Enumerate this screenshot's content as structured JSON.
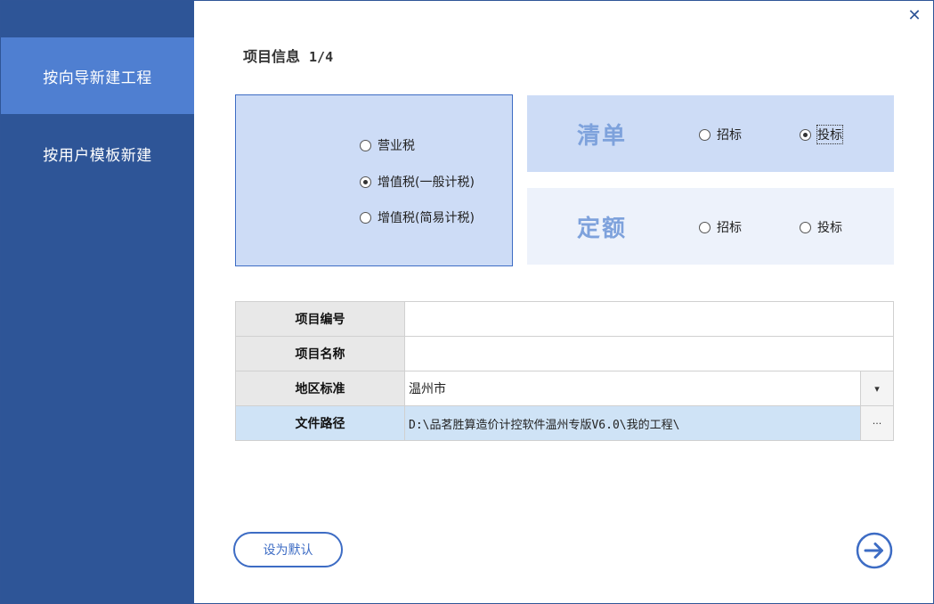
{
  "window": {
    "close_label": "✕"
  },
  "sidebar": {
    "items": [
      {
        "label": "按向导新建工程",
        "active": true
      },
      {
        "label": "按用户模板新建",
        "active": false
      }
    ]
  },
  "header": {
    "title": "项目信息",
    "step": "1/4"
  },
  "tax": {
    "options": [
      {
        "label": "营业税",
        "checked": false
      },
      {
        "label": "增值税(一般计税)",
        "checked": true
      },
      {
        "label": "增值税(简易计税)",
        "checked": false
      }
    ]
  },
  "bill": {
    "label": "清单",
    "options": [
      {
        "label": "招标",
        "checked": false
      },
      {
        "label": "投标",
        "checked": true
      }
    ]
  },
  "quota": {
    "label": "定额",
    "options": [
      {
        "label": "招标",
        "checked": false
      },
      {
        "label": "投标",
        "checked": false
      }
    ]
  },
  "form": {
    "project_no": {
      "label": "项目编号",
      "value": ""
    },
    "project_name": {
      "label": "项目名称",
      "value": ""
    },
    "region": {
      "label": "地区标准",
      "value": "温州市",
      "button": "▾"
    },
    "path": {
      "label": "文件路径",
      "value": "D:\\品茗胜算造价计控软件温州专版V6.0\\我的工程\\",
      "button": "···"
    }
  },
  "footer": {
    "default_label": "设为默认"
  },
  "colors": {
    "sidebar": "#2e5597",
    "active": "#4f7fd1",
    "accent": "#3d6cc4",
    "panel": "#cddcf6"
  }
}
